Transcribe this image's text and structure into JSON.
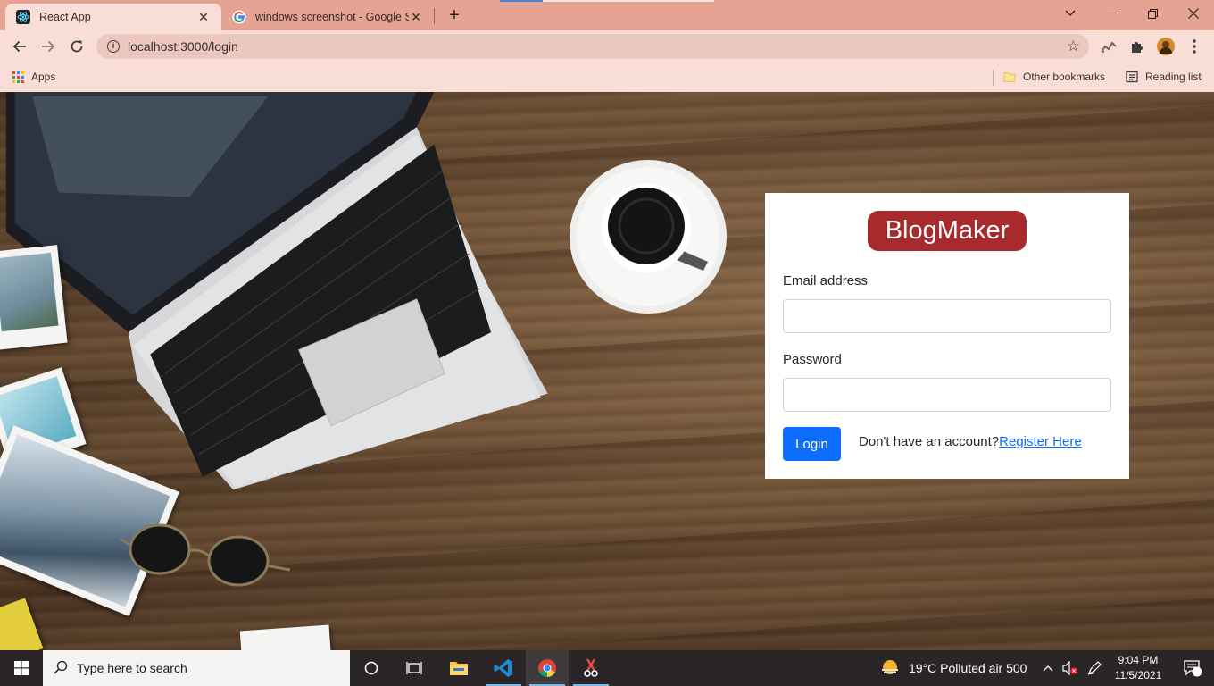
{
  "browser": {
    "tabs": [
      {
        "title": "React App",
        "active": true
      },
      {
        "title": "windows screenshot - Google Search",
        "active": false
      }
    ],
    "url": "localhost:3000/login",
    "bookmarks": {
      "apps_label": "Apps",
      "other_label": "Other bookmarks",
      "reading_label": "Reading list"
    }
  },
  "login": {
    "brand": "BlogMaker",
    "email_label": "Email address",
    "email_value": "",
    "password_label": "Password",
    "password_value": "",
    "login_button": "Login",
    "register_prompt": "Don't have an account?",
    "register_link": "Register Here"
  },
  "taskbar": {
    "search_placeholder": "Type here to search",
    "weather": "19°C  Polluted air 500",
    "time": "9:04 PM",
    "date": "11/5/2021",
    "notification_count": "1"
  },
  "colors": {
    "brand_bg": "#a82a2c",
    "primary": "#0d6efd",
    "tabstrip": "#e5a394",
    "toolbar": "#f9ded7"
  }
}
